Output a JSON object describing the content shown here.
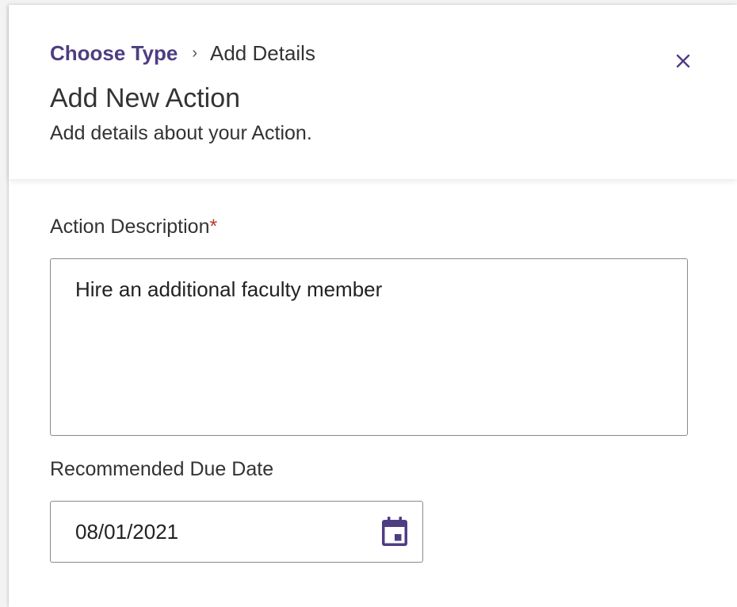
{
  "breadcrumb": {
    "step1": "Choose Type",
    "separator": "›",
    "step2": "Add Details"
  },
  "header": {
    "title": "Add New Action",
    "subtitle": "Add details about your Action."
  },
  "form": {
    "description": {
      "label": "Action Description",
      "required_mark": "*",
      "value": "Hire an additional faculty member"
    },
    "due_date": {
      "label": "Recommended Due Date",
      "value": "08/01/2021"
    }
  },
  "icons": {
    "close": "close-icon",
    "calendar": "calendar-icon"
  },
  "colors": {
    "accent": "#4f3d82",
    "required": "#c0392b",
    "text": "#333333",
    "border": "#8a8a8a"
  }
}
